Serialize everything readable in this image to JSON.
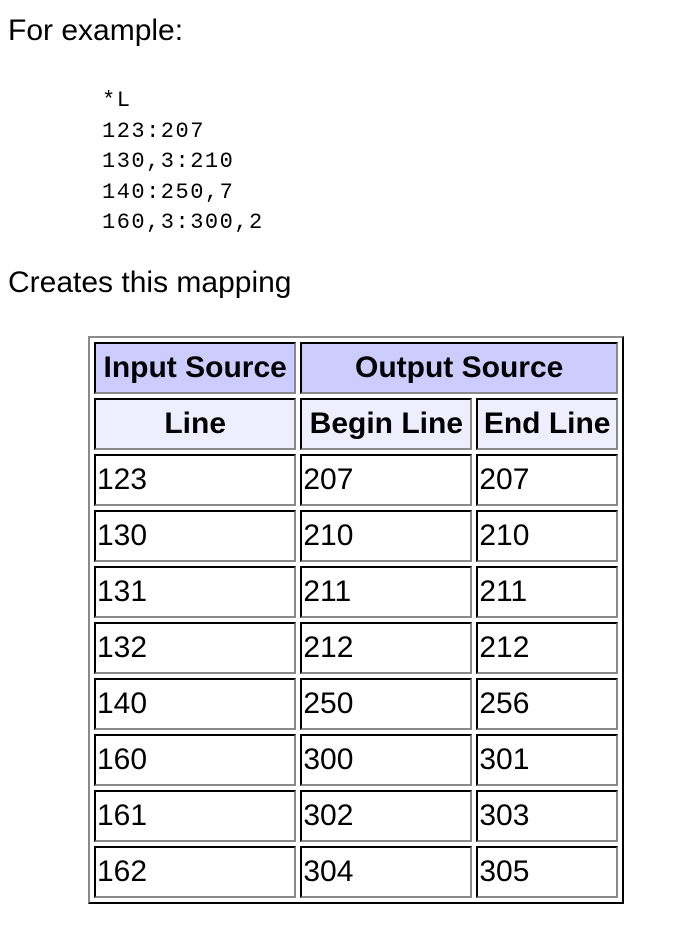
{
  "intro_text": "For example:",
  "code_lines": [
    "*L",
    "123:207",
    "130,3:210",
    "140:250,7",
    "160,3:300,2"
  ],
  "mapping_caption": "Creates this mapping",
  "table": {
    "header_groups": [
      "Input Source",
      "Output Source"
    ],
    "columns": [
      "Line",
      "Begin Line",
      "End Line"
    ],
    "header_colors": {
      "group": "#ccccff",
      "column": "#eeeeff"
    },
    "rows": [
      [
        "123",
        "207",
        "207"
      ],
      [
        "130",
        "210",
        "210"
      ],
      [
        "131",
        "211",
        "211"
      ],
      [
        "132",
        "212",
        "212"
      ],
      [
        "140",
        "250",
        "256"
      ],
      [
        "160",
        "300",
        "301"
      ],
      [
        "161",
        "302",
        "303"
      ],
      [
        "162",
        "304",
        "305"
      ]
    ]
  }
}
